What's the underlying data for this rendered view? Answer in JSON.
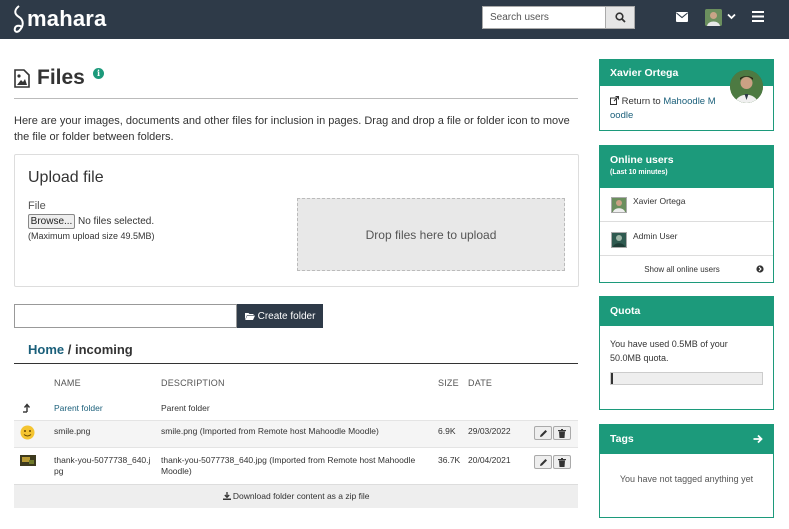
{
  "header": {
    "logo": "mahara",
    "search_placeholder": "Search users"
  },
  "page": {
    "title": "Files",
    "intro": "Here are your images, documents and other files for inclusion in pages. Drag and drop a file or folder icon to move the file or folder between folders."
  },
  "upload": {
    "title": "Upload file",
    "file_label": "File",
    "browse_label": "Browse...",
    "no_file": "No files selected.",
    "max_size": "(Maximum upload size 49.5MB)",
    "dropzone": "Drop files here to upload"
  },
  "folder": {
    "create_label": "Create folder"
  },
  "breadcrumb": {
    "home": "Home",
    "sep": " / ",
    "current": "incoming"
  },
  "table": {
    "headers": {
      "name": "NAME",
      "description": "DESCRIPTION",
      "size": "SIZE",
      "date": "DATE"
    },
    "rows": [
      {
        "name": "Parent folder",
        "description": "Parent folder",
        "size": "",
        "date": ""
      },
      {
        "name": "smile.png",
        "description": "smile.png (Imported from Remote host Mahoodle Moodle)",
        "size": "6.9K",
        "date": "29/03/2022"
      },
      {
        "name_line1": "thank-you-5077738_640.j",
        "name_line2": "pg",
        "desc_line1": "thank-you-5077738_640.jpg (Imported from Remote host Mahoodle",
        "desc_line2": "Moodle)",
        "size": "36.7K",
        "date": "20/04/2021"
      }
    ],
    "zip_label": "Download folder content as a zip file"
  },
  "sidebar": {
    "profile": {
      "name": "Xavier Ortega",
      "return_text": "Return to ",
      "return_link_line1": "Mahoodle M",
      "return_link_line2": "oodle"
    },
    "online": {
      "title": "Online users",
      "subtitle": "(Last 10 minutes)",
      "users": [
        "Xavier Ortega",
        "Admin User"
      ],
      "show_all": "Show all online users"
    },
    "quota": {
      "title": "Quota",
      "text_line1": "You have used 0.5MB of your",
      "text_line2": "50.0MB quota.",
      "used_fraction": 0.01
    },
    "tags": {
      "title": "Tags",
      "empty": "You have not tagged anything yet"
    }
  }
}
